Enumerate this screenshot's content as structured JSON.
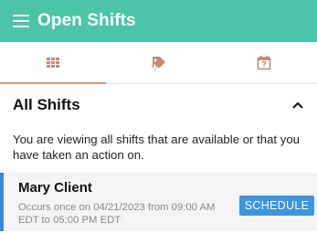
{
  "appbar": {
    "title": "Open Shifts",
    "background": "#4cc4a8"
  },
  "tabs": [
    {
      "icon": "grid-icon",
      "active": true
    },
    {
      "icon": "tag-add-icon",
      "active": false
    },
    {
      "icon": "calendar-question-icon",
      "active": false
    }
  ],
  "section": {
    "title": "All Shifts",
    "collapse_icon": "chevron-up-icon"
  },
  "description": "You are viewing all shifts that are available or that you have taken an action on.",
  "shifts": [
    {
      "client": "Mary Client",
      "detail": "Occurs once on 04/21/2023 from 09:00 AM EDT to 05:00 PM EDT",
      "action_label": "SCHEDULE",
      "accent_color": "#3a86d8",
      "button_color": "#3c95de"
    }
  ],
  "colors": {
    "active_tab_indicator": "#d6967a",
    "icon_tint": "#c58a73"
  }
}
